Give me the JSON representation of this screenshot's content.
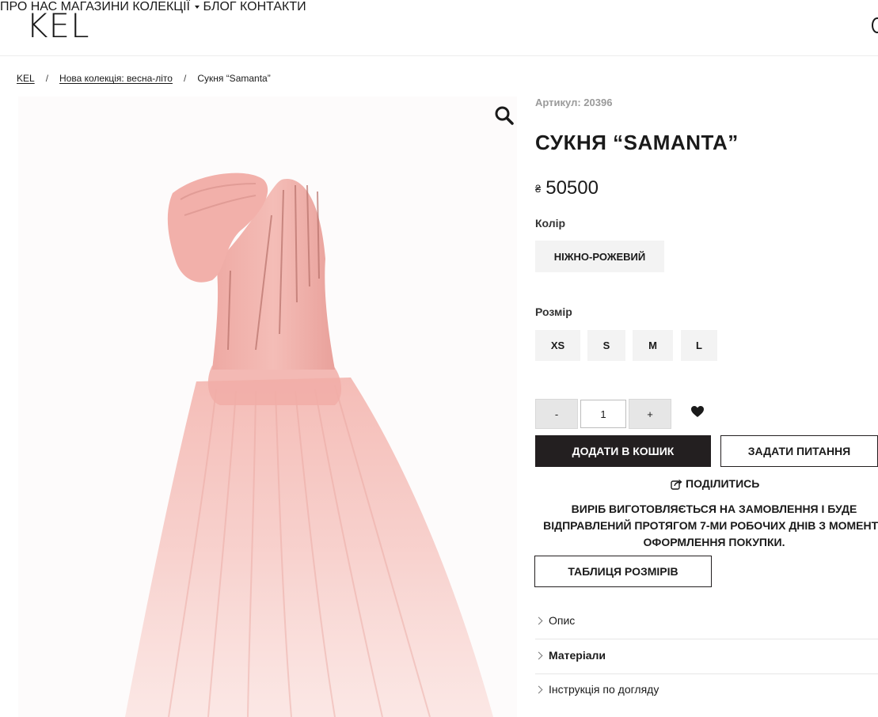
{
  "header": {
    "logo": "KEL",
    "nav": [
      {
        "label": "ПРО НАС"
      },
      {
        "label": "МАГАЗИНИ"
      },
      {
        "label": "КОЛЕКЦІЇ",
        "has_dropdown": true
      },
      {
        "label": "БЛОГ"
      },
      {
        "label": "КОНТАКТИ"
      }
    ]
  },
  "breadcrumb": {
    "items": [
      "KEL",
      "Нова колекція: весна-літо"
    ],
    "separator": "/",
    "current": "Сукня “Samanta”"
  },
  "product": {
    "image_alt": "pink tulle gown",
    "sku_label": "Артикул: 20396",
    "title": "СУКНЯ “SAMANTA”",
    "currency_symbol": "₴",
    "price": "50500",
    "color_label": "Колір",
    "color_value": "НІЖНО-РОЖЕВИЙ",
    "size_label": "Розмір",
    "sizes": [
      "XS",
      "S",
      "M",
      "L"
    ],
    "quantity": {
      "minus_label": "-",
      "value": "1",
      "plus_label": "+"
    },
    "add_to_cart_label": "ДОДАТИ В КОШИК",
    "ask_question_label": "ЗАДАТИ ПИТАННЯ",
    "share_label": "ПОДІЛИТИСЬ",
    "notice": "ВИРІБ ВИГОТОВЛЯЄТЬСЯ НА ЗАМОВЛЕННЯ І БУДЕ ВІДПРАВЛЕНИЙ ПРОТЯГОМ 7-МИ РОБОЧИХ ДНІВ З МОМЕНТУ ОФОРМЛЕННЯ ПОКУПКИ.",
    "size_chart_label": "ТАБЛИЦЯ РОЗМІРІВ",
    "accordion": [
      {
        "label": "Опис",
        "bold": false
      },
      {
        "label": "Матеріали",
        "bold": true
      },
      {
        "label": "Інструкція по догляду",
        "bold": false
      }
    ]
  },
  "colors": {
    "dark": "#231f20",
    "chip_bg": "#f3f3f3",
    "sku_grey": "#9a9a9a",
    "dress_pink": "#f2b3ae"
  },
  "icons": [
    "search-icon",
    "heart-icon",
    "share-icon",
    "chevron-right-icon",
    "caret-down-icon"
  ]
}
